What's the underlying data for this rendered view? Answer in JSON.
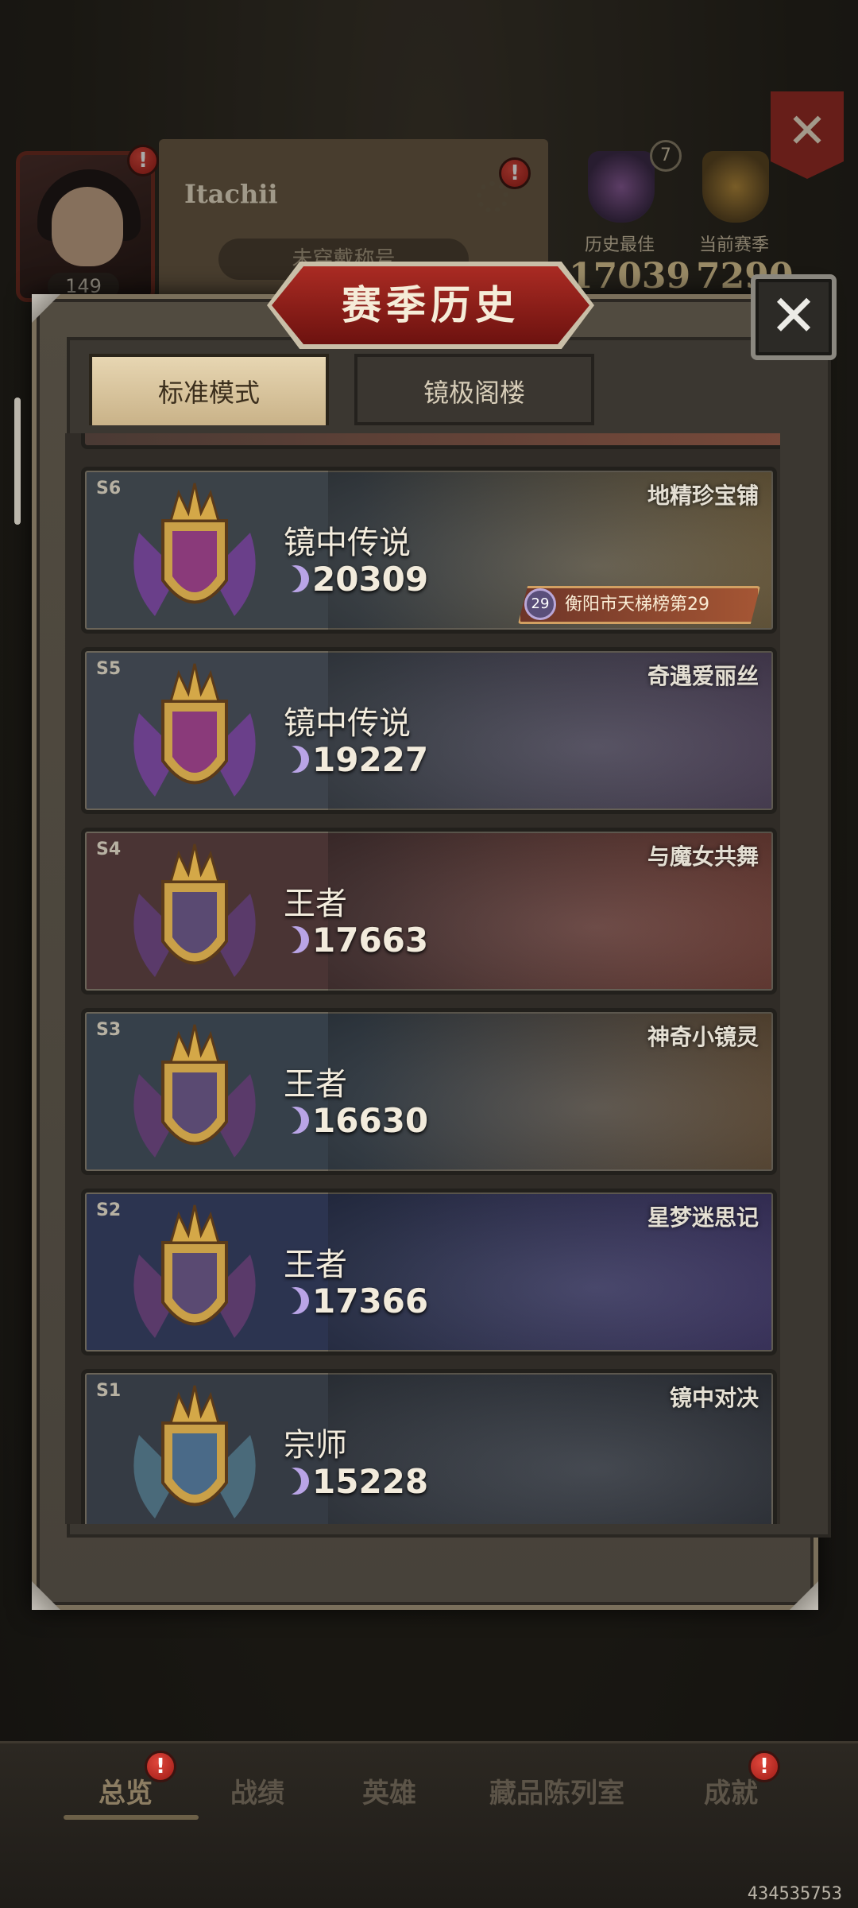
{
  "profile": {
    "name": "Itachii",
    "level": "149",
    "title_placeholder": "未穿戴称号",
    "history_best_label": "历史最佳",
    "history_best_value": "17039",
    "current_season_label": "当前赛季",
    "current_season_value": "7290",
    "rank_badge": "7",
    "notification_count": "!"
  },
  "dialog": {
    "title": "赛季历史",
    "close_symbol": "✕",
    "tabs": [
      {
        "label": "标准模式",
        "active": true
      },
      {
        "label": "镜极阁楼",
        "active": false
      }
    ]
  },
  "seasons": [
    {
      "season": "S6",
      "rank": "镜中传说",
      "score": "20309",
      "subtitle": "地精珍宝铺",
      "location": "衡阳市天梯榜第29",
      "location_num": "29",
      "colors": [
        "#3b4248",
        "#6b5a3a"
      ]
    },
    {
      "season": "S5",
      "rank": "镜中传说",
      "score": "19227",
      "subtitle": "奇遇爱丽丝",
      "colors": [
        "#3d434c",
        "#4a3e56"
      ]
    },
    {
      "season": "S4",
      "rank": "王者",
      "score": "17663",
      "subtitle": "与魔女共舞",
      "colors": [
        "#4a3434",
        "#6b3a32"
      ]
    },
    {
      "season": "S3",
      "rank": "王者",
      "score": "16630",
      "subtitle": "神奇小镜灵",
      "colors": [
        "#36404a",
        "#5e4a34"
      ]
    },
    {
      "season": "S2",
      "rank": "王者",
      "score": "17366",
      "subtitle": "星梦迷思记",
      "colors": [
        "#2c3450",
        "#3a3262"
      ]
    },
    {
      "season": "S1",
      "rank": "宗师",
      "score": "15228",
      "subtitle": "镜中对决",
      "colors": [
        "#353b44",
        "#2c3038"
      ]
    }
  ],
  "nav": {
    "items": [
      "总览",
      "战绩",
      "英雄",
      "藏品陈列室",
      "成就"
    ],
    "active": "总览"
  },
  "uid": "434535753",
  "icons": {
    "close": "close-icon",
    "settings": "gear-icon",
    "crest": "season-crest-icon",
    "moon": "crescent-moon-icon"
  }
}
